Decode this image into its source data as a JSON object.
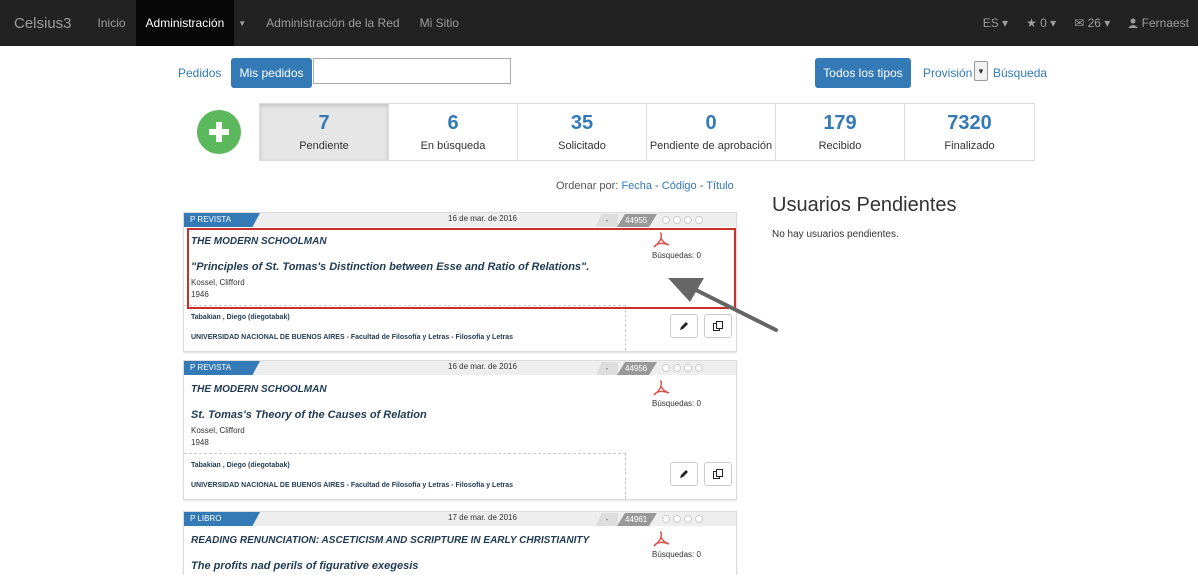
{
  "navbar": {
    "brand": "Celsius3",
    "items": [
      "Inicio",
      "Administración",
      "Administración de la Red",
      "Mi Sitio"
    ],
    "active_index": 1,
    "lang": "ES ▾",
    "favorites": "★ 0 ▾",
    "messages": "✉ 26 ▾",
    "user": "Fernaest"
  },
  "filterbar": {
    "pedidos": "Pedidos",
    "mis_pedidos": "Mis pedidos",
    "select_value": "",
    "todos_tipos": "Todos los tipos",
    "provision": "Provisión",
    "busqueda": "Búsqueda"
  },
  "stats": [
    {
      "num": "7",
      "label": "Pendiente",
      "active": true
    },
    {
      "num": "6",
      "label": "En búsqueda"
    },
    {
      "num": "35",
      "label": "Solicitado"
    },
    {
      "num": "0",
      "label": "Pendiente de aprobación"
    },
    {
      "num": "179",
      "label": "Recibido"
    },
    {
      "num": "7320",
      "label": "Finalizado"
    }
  ],
  "ordenar": {
    "prefix": "Ordenar por:",
    "fecha": "Fecha",
    "codigo": "Código",
    "titulo": "Título"
  },
  "usuarios": {
    "title": "Usuarios Pendientes",
    "empty": "No hay usuarios pendientes."
  },
  "orders": [
    {
      "type": "P  REVISTA",
      "date": "16 de mar. de 2016",
      "dash": "-",
      "id": "44955",
      "journal": "THE MODERN SCHOOLMAN",
      "article": "\"Principles of St. Tomas's Distinction between Esse and Ratio of Relations\".",
      "author": "Kossel, Clifford",
      "year": "1946",
      "busquedas": "Búsquedas: 0",
      "requester": "Tabakian , Diego (diegotabak)",
      "institution": "UNIVERSIDAD NACIONAL DE BUENOS AIRES - Facultad de Filosofía y Letras - Filosofía y Letras"
    },
    {
      "type": "P  REVISTA",
      "date": "16 de mar. de 2016",
      "dash": "-",
      "id": "44956",
      "journal": "THE MODERN SCHOOLMAN",
      "article": "St. Tomas's Theory of the Causes of Relation",
      "author": "Kossel, Clifford",
      "year": "1948",
      "busquedas": "Búsquedas: 0",
      "requester": "Tabakian , Diego (diegotabak)",
      "institution": "UNIVERSIDAD NACIONAL DE BUENOS AIRES - Facultad de Filosofía y Letras - Filosofía y Letras"
    },
    {
      "type": "P  LIBRO",
      "date": "17 de mar. de 2016",
      "dash": "-",
      "id": "44961",
      "journal": "READING RENUNCIATION: ASCETICISM AND SCRIPTURE IN EARLY CHRISTIANITY",
      "article": "The profits nad perils of figurative exegesis",
      "busquedas": "Búsquedas: 0"
    }
  ],
  "colors": {
    "navbar_bg": "#222222",
    "primary": "#337ab7",
    "success": "#5cb85c",
    "highlight": "#c9302c",
    "pdf": "#d9534f"
  }
}
